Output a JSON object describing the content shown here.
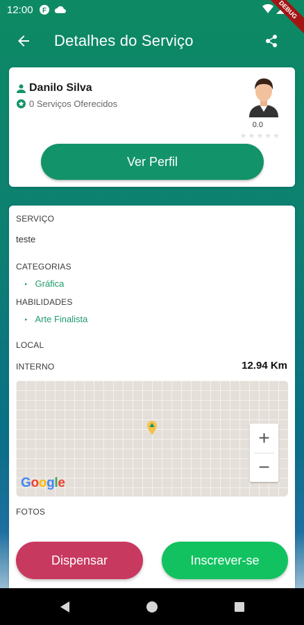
{
  "status_bar": {
    "time": "12:00",
    "debug_label": "DEBUG"
  },
  "app_bar": {
    "title": "Detalhes do Serviço"
  },
  "profile": {
    "name": "Danilo Silva",
    "services_offered": "0 Serviços Oferecidos",
    "rating": "0.0",
    "stars_filled": 0,
    "stars_total": 5,
    "button_label": "Ver Perfil"
  },
  "details": {
    "service_label": "SERVIÇO",
    "service_value": "teste",
    "categories_label": "CATEGORIAS",
    "categories": [
      "Gráfica"
    ],
    "skills_label": "HABILIDADES",
    "skills": [
      "Arte Finalista"
    ],
    "local_label": "LOCAL",
    "location_type": "INTERNO",
    "distance": "12.94 Km",
    "photos_label": "FOTOS"
  },
  "map": {
    "google_logo": "Google",
    "zoom_in": "+",
    "zoom_out": "−"
  },
  "actions": {
    "dismiss_label": "Dispensar",
    "subscribe_label": "Inscrever-se"
  },
  "colors": {
    "primary": "#13936a",
    "dismiss": "#c8395f",
    "subscribe": "#12c260",
    "link_green": "#1f9a6a"
  }
}
